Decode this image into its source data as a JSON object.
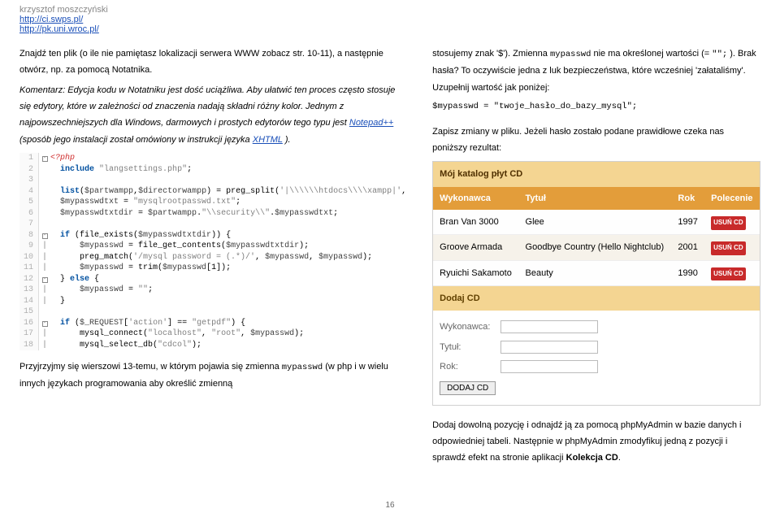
{
  "header": {
    "author": "krzysztof moszczyński",
    "link1": "http://ci.swps.pl/",
    "link2": "http://pk.uni.wroc.pl/"
  },
  "left": {
    "p1a": "Znajdź ten plik (o ile nie pamiętasz lokalizacji serwera WWW zobacz str. 10-11), a następnie otwórz, np. za pomocą Notatnika.",
    "p2a": "Komentarz: Edycja kodu w Notatniku jest dość uciążliwa. Aby ułatwić ten proces często stosuje się edytory, które w zależności od znaczenia nadają składni różny kolor. Jednym z najpowszechniejszych dla Windows, darmowych i prostych edytorów tego typu jest ",
    "p2link1": "Notepad++",
    "p2b": " (sposób jego instalacji został omówiony w instrukcji języka ",
    "p2link2": "XHTML",
    "p2c": ").",
    "p3a": "Przyjrzyjmy się wierszowi 13-temu, w którym pojawia się zmienna ",
    "p3code": "mypasswd",
    "p3b": " (w php i w wielu innych językach programowania aby określić zmienną"
  },
  "code": {
    "l1": "<?php",
    "l2": "include \"langsettings.php\";",
    "l4": "list($partwampp,$directorwampp) = preg_split('|\\\\\\\\htdocs\\\\\\\\xampp|',",
    "l5": "$mypasswdtxt = \"mysqlrootpasswd.txt\";",
    "l6": "$mypasswdtxtdir = $partwampp.\"\\\\security\\\\\".$mypasswdtxt;",
    "l8": "if (file_exists($mypasswdtxtdir)) {",
    "l9": "    $mypasswd = file_get_contents($mypasswdtxtdir);",
    "l10": "    preg_match('/mysql password = (.*)/', $mypasswd, $mypasswd);",
    "l11": "    $mypasswd = trim($mypasswd[1]);",
    "l12": "} else {",
    "l13": "    $mypasswd = \"\";",
    "l14": "}",
    "l16": "if ($_REQUEST['action'] == \"getpdf\") {",
    "l17": "    mysql_connect(\"localhost\", \"root\", $mypasswd);",
    "l18": "    mysql_select_db(\"cdcol\");"
  },
  "right": {
    "p1a": "stosujemy znak '$'). Zmienna ",
    "p1code": "mypasswd",
    "p1b": " nie ma określonej wartości (= ",
    "p1code2": "\"\";",
    "p1c": "). Brak hasła? To oczywiście jedna z luk bezpieczeństwa, które wcześniej 'załataliśmy'. Uzupełnij wartość jak poniżej:",
    "codeassign": "$mypasswd = \"twoje_hasło_do_bazy_mysql\";",
    "p2": "Zapisz zmiany w pliku. Jeżeli hasło zostało podane prawidłowe czeka nas poniższy rezultat:",
    "p3a": "Dodaj dowolną pozycję i odnajdź ją za pomocą phpMyAdmin w bazie danych i odpowiedniej tabeli. Następnie w phpMyAdmin zmodyfikuj jedną z pozycji i sprawdź efekt na stronie aplikacji ",
    "p3bold": "Kolekcja CD",
    "p3b": "."
  },
  "app": {
    "title": "Mój katalog płyt CD",
    "headers": [
      "Wykonawca",
      "Tytuł",
      "Rok",
      "Polecenie"
    ],
    "rows": [
      {
        "artist": "Bran Van 3000",
        "title": "Glee",
        "year": "1997",
        "cmd": "USUŃ CD"
      },
      {
        "artist": "Groove Armada",
        "title": "Goodbye Country (Hello Nightclub)",
        "year": "2001",
        "cmd": "USUŃ CD"
      },
      {
        "artist": "Ryuichi Sakamoto",
        "title": "Beauty",
        "year": "1990",
        "cmd": "USUŃ CD"
      }
    ],
    "form_title": "Dodaj CD",
    "labels": {
      "artist": "Wykonawca:",
      "title": "Tytuł:",
      "year": "Rok:"
    },
    "submit": "DODAJ CD"
  },
  "pagenum": "16"
}
